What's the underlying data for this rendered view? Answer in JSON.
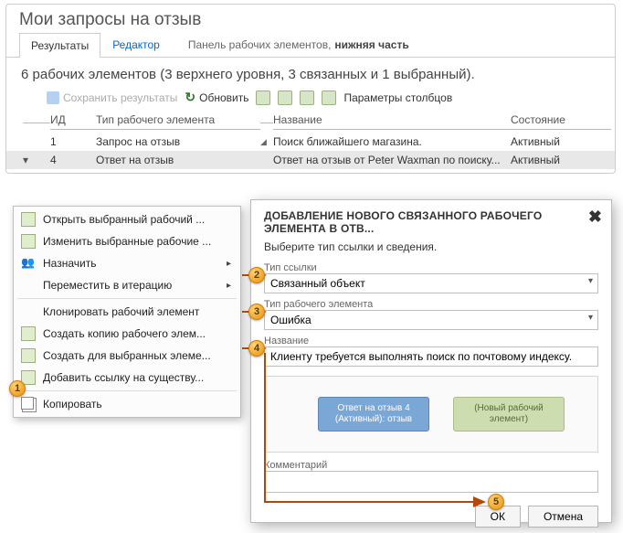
{
  "page_title": "Мои запросы на отзыв",
  "tabs": {
    "results": "Результаты",
    "editor": "Редактор",
    "panel_prefix": "Панель рабочих элементов,",
    "panel_bold": "нижняя часть"
  },
  "summary": "6 рабочих элементов (3 верхнего уровня, 3 связанных и 1 выбранный).",
  "toolbar": {
    "save": "Сохранить результаты",
    "refresh": "Обновить",
    "columns": "Параметры столбцов"
  },
  "grid": {
    "headers": {
      "id": "ИД",
      "type": "Тип рабочего элемента",
      "title": "Название",
      "state": "Состояние"
    },
    "rows": [
      {
        "id": "1",
        "type": "Запрос на отзыв",
        "title": "Поиск ближайшего магазина.",
        "state": "Активный",
        "expand": "◢"
      },
      {
        "id": "4",
        "type": "Ответ на отзыв",
        "title": "Ответ на отзыв от Peter Waxman по поиску...",
        "state": "Активный",
        "expand": ""
      }
    ]
  },
  "ctx": {
    "open": "Открыть выбранный рабочий ...",
    "edit": "Изменить выбранные рабочие ...",
    "assign": "Назначить",
    "move": "Переместить в итерацию",
    "clone": "Клонировать рабочий элемент",
    "copywi": "Создать копию рабочего элем...",
    "createfor": "Создать для выбранных элеме...",
    "addlink": "Добавить ссылку на существу...",
    "copy": "Копировать"
  },
  "dialog": {
    "title": "ДОБАВЛЕНИЕ НОВОГО СВЯЗАННОГО РАБОЧЕГО ЭЛЕМЕНТА В ОТВ...",
    "subtitle": "Выберите тип ссылки и сведения.",
    "link_type_label": "Тип ссылки",
    "link_type_value": "Связанный объект",
    "wi_type_label": "Тип рабочего элемента",
    "wi_type_value": "Ошибка",
    "name_label": "Название",
    "name_value": "Клиенту требуется выполнять поиск по почтовому индексу.",
    "node_left": "Ответ на отзыв 4 (Активный): отзыв",
    "node_right": "(Новый рабочий элемент)",
    "comment_label": "Комментарий",
    "ok": "ОК",
    "cancel": "Отмена"
  },
  "badges": {
    "b1": "1",
    "b2": "2",
    "b3": "3",
    "b4": "4",
    "b5": "5"
  }
}
